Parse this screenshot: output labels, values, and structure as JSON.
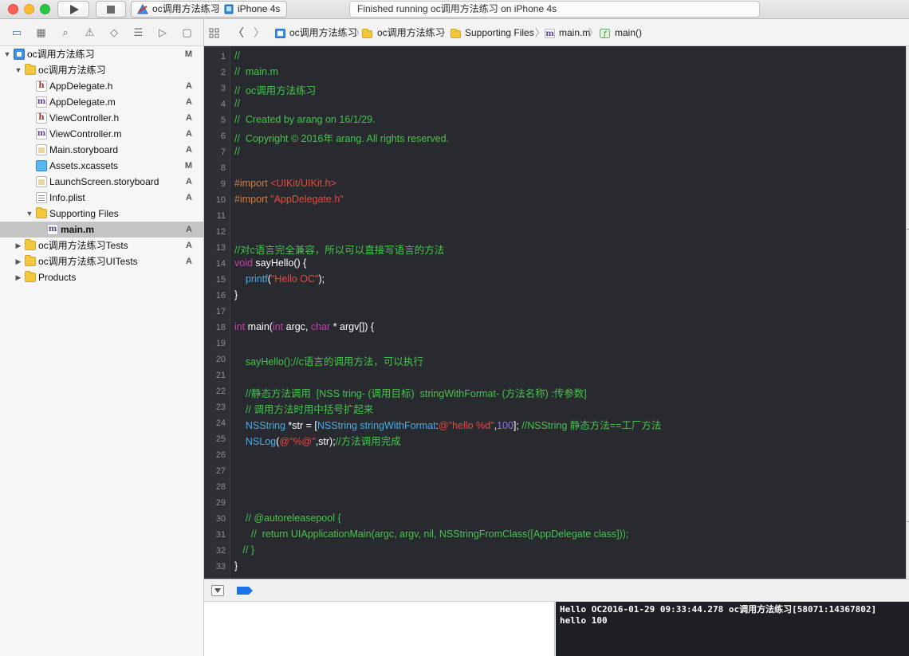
{
  "toolbar": {
    "scheme_name": "oc调用方法练习",
    "scheme_separator": "〉",
    "device_name": "iPhone 4s",
    "activity_text": "Finished running oc调用方法练习 on iPhone 4s"
  },
  "navigator": {
    "tabs": [
      "folder-icon",
      "symbol-icon",
      "search-icon",
      "issue-icon",
      "test-icon",
      "debug-icon",
      "breakpoint-icon",
      "report-icon"
    ],
    "items": [
      {
        "name": "oc调用方法练习",
        "status": "M",
        "kind": "project",
        "level": 0,
        "disclosure": "open"
      },
      {
        "name": "oc调用方法练习",
        "status": "",
        "kind": "folder",
        "level": 1,
        "disclosure": "open"
      },
      {
        "name": "AppDelegate.h",
        "status": "A",
        "kind": "h",
        "level": 2,
        "disclosure": ""
      },
      {
        "name": "AppDelegate.m",
        "status": "A",
        "kind": "m",
        "level": 2,
        "disclosure": ""
      },
      {
        "name": "ViewController.h",
        "status": "A",
        "kind": "h",
        "level": 2,
        "disclosure": ""
      },
      {
        "name": "ViewController.m",
        "status": "A",
        "kind": "m",
        "level": 2,
        "disclosure": ""
      },
      {
        "name": "Main.storyboard",
        "status": "A",
        "kind": "storyboard",
        "level": 2,
        "disclosure": ""
      },
      {
        "name": "Assets.xcassets",
        "status": "M",
        "kind": "assets",
        "level": 2,
        "disclosure": ""
      },
      {
        "name": "LaunchScreen.storyboard",
        "status": "A",
        "kind": "storyboard",
        "level": 2,
        "disclosure": ""
      },
      {
        "name": "Info.plist",
        "status": "A",
        "kind": "plist",
        "level": 2,
        "disclosure": ""
      },
      {
        "name": "Supporting Files",
        "status": "",
        "kind": "folder",
        "level": 2,
        "disclosure": "open"
      },
      {
        "name": "main.m",
        "status": "A",
        "kind": "m",
        "level": 3,
        "disclosure": "",
        "selected": true
      },
      {
        "name": "oc调用方法练习Tests",
        "status": "A",
        "kind": "folder",
        "level": 1,
        "disclosure": "closed"
      },
      {
        "name": "oc调用方法练习UITests",
        "status": "A",
        "kind": "folder",
        "level": 1,
        "disclosure": "closed"
      },
      {
        "name": "Products",
        "status": "",
        "kind": "folder",
        "level": 1,
        "disclosure": "closed"
      }
    ]
  },
  "jumpbar": {
    "crumbs": [
      "oc调用方法练习",
      "oc调用方法练习",
      "Supporting Files",
      "main.m",
      "main()"
    ],
    "back_label": "〈",
    "forward_label": "〉"
  },
  "editor": {
    "line_numbers": [
      "1",
      "2",
      "3",
      "4",
      "5",
      "6",
      "7",
      "8",
      "9",
      "10",
      "11",
      "12",
      "13",
      "14",
      "15",
      "16",
      "17",
      "18",
      "19",
      "20",
      "21",
      "22",
      "23",
      "24",
      "25",
      "26",
      "27",
      "28",
      "29",
      "30",
      "31",
      "32",
      "33"
    ],
    "lines": [
      [
        {
          "t": "c",
          "s": "//"
        }
      ],
      [
        {
          "t": "c",
          "s": "//  main.m"
        }
      ],
      [
        {
          "t": "c",
          "s": "//  oc调用方法练习"
        }
      ],
      [
        {
          "t": "c",
          "s": "//"
        }
      ],
      [
        {
          "t": "c",
          "s": "//  Created by arang on 16/1/29."
        }
      ],
      [
        {
          "t": "c",
          "s": "//  Copyright © 2016年 arang. All rights reserved."
        }
      ],
      [
        {
          "t": "c",
          "s": "//"
        }
      ],
      [],
      [
        {
          "t": "pp",
          "s": "#import "
        },
        {
          "t": "str",
          "s": "<UIKit/UIKit.h>"
        }
      ],
      [
        {
          "t": "pp",
          "s": "#import "
        },
        {
          "t": "str",
          "s": "\"AppDelegate.h\""
        }
      ],
      [],
      [],
      [
        {
          "t": "c",
          "s": "//对c语言完全兼容，所以可以直接写语言的方法"
        }
      ],
      [
        {
          "t": "kw",
          "s": "void"
        },
        {
          "t": "plain",
          "s": " sayHello() {"
        }
      ],
      [
        {
          "t": "plain",
          "s": "    "
        },
        {
          "t": "fn",
          "s": "printf"
        },
        {
          "t": "plain",
          "s": "("
        },
        {
          "t": "str",
          "s": "\"Hello OC\""
        },
        {
          "t": "plain",
          "s": ");"
        }
      ],
      [
        {
          "t": "plain",
          "s": "}"
        }
      ],
      [],
      [
        {
          "t": "kw",
          "s": "int"
        },
        {
          "t": "plain",
          "s": " main("
        },
        {
          "t": "kw",
          "s": "int"
        },
        {
          "t": "plain",
          "s": " argc, "
        },
        {
          "t": "kw",
          "s": "char"
        },
        {
          "t": "plain",
          "s": " * argv[]) {"
        }
      ],
      [],
      [
        {
          "t": "plain",
          "s": "    "
        },
        {
          "t": "c",
          "s": "sayHello();//c语言的调用方法，可以执行"
        }
      ],
      [],
      [
        {
          "t": "plain",
          "s": "    "
        },
        {
          "t": "c",
          "s": "//静态方法调用  [NSS tring- (调用目标)  stringWithFormat- (方法名称) :传参数]"
        }
      ],
      [
        {
          "t": "plain",
          "s": "    "
        },
        {
          "t": "c",
          "s": "// 调用方法时用中括号扩起来"
        }
      ],
      [
        {
          "t": "plain",
          "s": "    "
        },
        {
          "t": "fn",
          "s": "NSString"
        },
        {
          "t": "plain",
          "s": " *str = ["
        },
        {
          "t": "fn",
          "s": "NSString"
        },
        {
          "t": "plain",
          "s": " "
        },
        {
          "t": "fn",
          "s": "stringWithFormat"
        },
        {
          "t": "plain",
          "s": ":"
        },
        {
          "t": "str",
          "s": "@\"hello %d\""
        },
        {
          "t": "plain",
          "s": ","
        },
        {
          "t": "num",
          "s": "100"
        },
        {
          "t": "plain",
          "s": "]; "
        },
        {
          "t": "c",
          "s": "//NSString 静态方法==工厂方法"
        }
      ],
      [
        {
          "t": "plain",
          "s": "    "
        },
        {
          "t": "fn",
          "s": "NSLog"
        },
        {
          "t": "plain",
          "s": "("
        },
        {
          "t": "str",
          "s": "@\"%@\""
        },
        {
          "t": "plain",
          "s": ",str);"
        },
        {
          "t": "c",
          "s": "//方法调用完成"
        }
      ],
      [],
      [],
      [],
      [],
      [
        {
          "t": "plain",
          "s": "    "
        },
        {
          "t": "c",
          "s": "// @autoreleasepool {"
        }
      ],
      [
        {
          "t": "plain",
          "s": "      "
        },
        {
          "t": "c",
          "s": "//  return UIApplicationMain(argc, argv, nil, NSStringFromClass([AppDelegate class]));"
        }
      ],
      [
        {
          "t": "plain",
          "s": "   "
        },
        {
          "t": "c",
          "s": "// }"
        }
      ],
      [
        {
          "t": "plain",
          "s": "}"
        }
      ]
    ]
  },
  "console": {
    "lines": [
      "Hello OC2016-01-29 09:33:44.278 oc调用方法练习[58071:14367802]",
      "hello 100"
    ]
  },
  "colors": {
    "editor_bg": "#292a30",
    "comment": "#41c749",
    "keyword": "#ca3fa9",
    "string": "#f0443f",
    "preprocessor": "#dd7a2c",
    "function": "#40aeef",
    "number": "#8e79e8"
  }
}
